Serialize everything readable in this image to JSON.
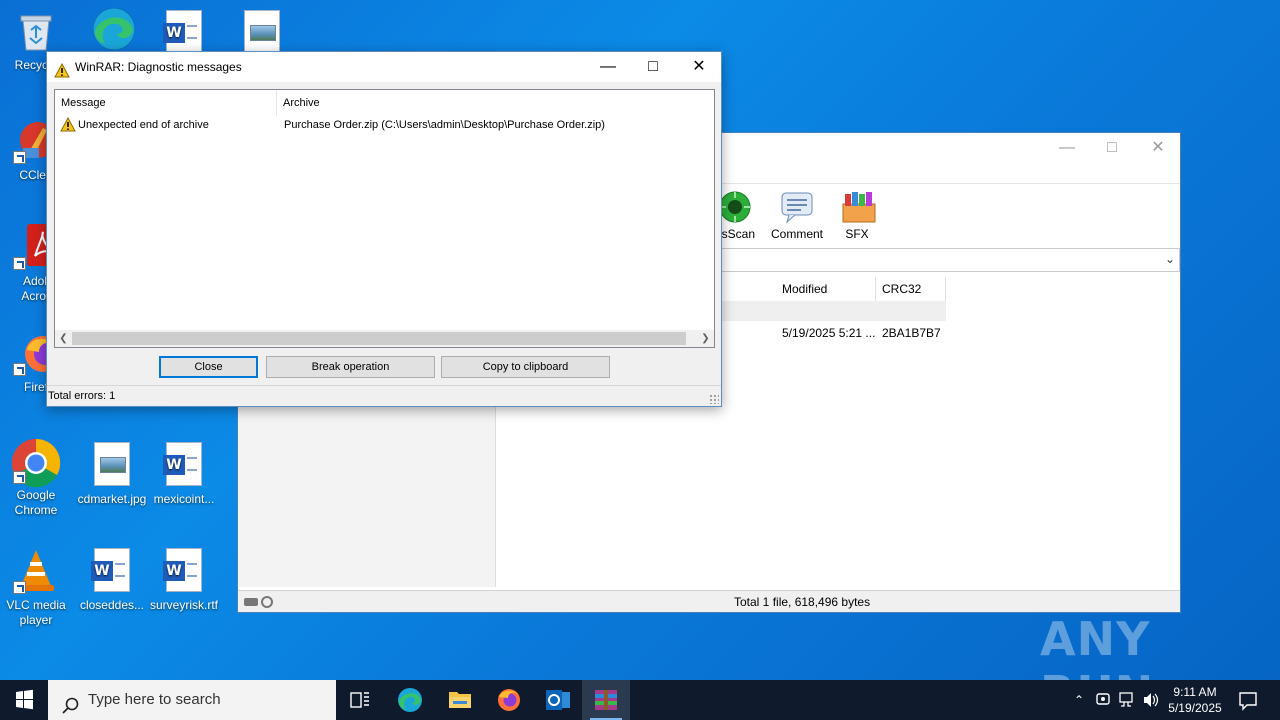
{
  "desktop": {
    "icons": [
      {
        "label": "Recycle",
        "name": "recycle-bin"
      },
      {
        "label": "CClea",
        "name": "ccleaner"
      },
      {
        "label": "Adob Acrob",
        "name": "adobe-acrobat"
      },
      {
        "label": "Firef",
        "name": "firefox"
      },
      {
        "label": "Google Chrome",
        "name": "google-chrome"
      },
      {
        "label": "cdmarket.jpg",
        "name": "cdmarket-jpg"
      },
      {
        "label": "mexicoint...",
        "name": "mexicoint"
      },
      {
        "label": "VLC media player",
        "name": "vlc"
      },
      {
        "label": "closeddes...",
        "name": "closeddes"
      },
      {
        "label": "surveyrisk.rtf",
        "name": "surveyrisk-rtf"
      }
    ]
  },
  "main_window": {
    "toolbar": {
      "virus_scan": "usScan",
      "comment": "Comment",
      "sfx": "SFX"
    },
    "columns": {
      "modified": "Modified",
      "crc32": "CRC32"
    },
    "file_row": {
      "modified": "5/19/2025 5:21 ...",
      "crc32": "2BA1B7B7"
    },
    "status": "Total 1 file, 618,496 bytes"
  },
  "dialog": {
    "title": "WinRAR: Diagnostic messages",
    "columns": {
      "message": "Message",
      "archive": "Archive"
    },
    "rows": [
      {
        "message": "Unexpected end of archive",
        "archive": "Purchase Order.zip (C:\\Users\\admin\\Desktop\\Purchase Order.zip)"
      }
    ],
    "buttons": {
      "close": "Close",
      "break": "Break operation",
      "copy": "Copy to clipboard"
    },
    "status": "Total errors: 1"
  },
  "taskbar": {
    "search_placeholder": "Type here to search",
    "time": "9:11 AM",
    "date": "5/19/2025"
  },
  "watermark": "ANY RUN",
  "colors": {
    "accent": "#0078d7",
    "taskbar": "#0f1b2c",
    "warning": "#f5c518"
  }
}
